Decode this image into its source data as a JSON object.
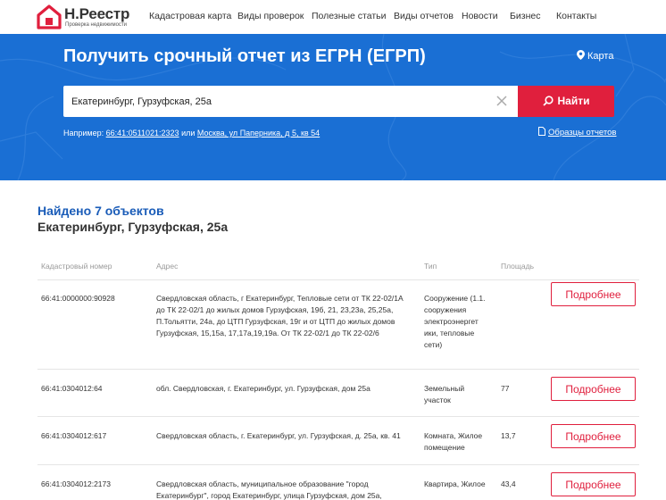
{
  "brand": {
    "name": "Н.Реестр",
    "tagline": "Проверка недвижимости",
    "accent_color": "#e01f3d"
  },
  "nav": {
    "items": [
      "Кадастровая карта",
      "Виды проверок",
      "Полезные статьи",
      "Виды отчетов",
      "Новости",
      "Бизнес",
      "Контакты"
    ]
  },
  "hero": {
    "title": "Получить срочный отчет из ЕГРН (ЕГРП)",
    "map_link": "Карта",
    "background_color": "#1a6fd4",
    "search": {
      "value": "Екатеринбург, Гурзуфская, 25а",
      "button_label": "Найти"
    },
    "example": {
      "prefix": "Например:",
      "link1": "66:41:0511021:2323",
      "or": "или",
      "link2": "Москва, ул Паперника, д 5, кв 54"
    },
    "samples_link": "Образцы отчетов"
  },
  "results": {
    "found_title": "Найдено 7 объектов",
    "address": "Екатеринбург, Гурзуфская, 25а",
    "columns": {
      "cadastral": "Кадастровый номер",
      "address": "Адрес",
      "type": "Тип",
      "area": "Площадь"
    },
    "detail_label": "Подробнее",
    "rows": [
      {
        "cadastral": "66:41:0000000:90928",
        "address": "Свердловская область, г Екатеринбург, Тепловые сети от ТК 22-02/1А до ТК 22-02/1 до жилых домов Гурзуфская, 19б, 21, 23,23а, 25,25а, П.Тольятти, 24а, до ЦТП Гурзуфская, 19г и от ЦТП до жилых домов Гурзуфская, 15,15а, 17,17а,19,19а. От ТК 22-02/1 до ТК 22-02/6",
        "type": "Сооружение (1.1. сооружения электроэнергет ики, тепловые сети)",
        "area": ""
      },
      {
        "cadastral": "66:41:0304012:64",
        "address": "обл. Свердловская, г. Екатеринбург, ул. Гурзуфская, дом 25а",
        "type": "Земельный участок",
        "area": "77"
      },
      {
        "cadastral": "66:41:0304012:617",
        "address": "Свердловская область, г. Екатеринбург, ул. Гурзуфская, д. 25а, кв. 41",
        "type": "Комната, Жилое помещение",
        "area": "13,7"
      },
      {
        "cadastral": "66:41:0304012:2173",
        "address": "Свердловская область, муниципальное образование \"город Екатеринбург\", город Екатеринбург, улица Гурзуфская, дом 25а,",
        "type": "Квартира, Жилое",
        "area": "43,4"
      }
    ]
  }
}
